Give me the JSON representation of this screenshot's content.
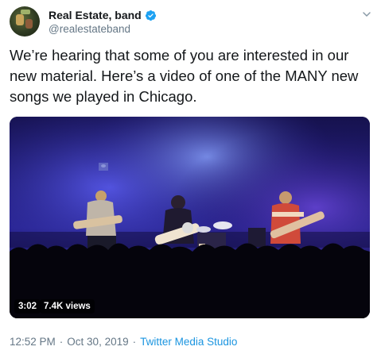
{
  "author": {
    "display_name": "Real Estate, band",
    "handle": "@realestateband",
    "verified": true
  },
  "tweet": {
    "text_lines": [
      "We’re hearing that some of you are interested in our",
      "new material. Here’s a video of one of the MANY new",
      "songs we played in Chicago."
    ]
  },
  "video": {
    "duration": "3:02",
    "views": "7.4K views"
  },
  "meta": {
    "time": "12:52 PM",
    "separator": "·",
    "date": "Oct 30, 2019",
    "source": "Twitter Media Studio"
  },
  "icons": {
    "verified": "verified-badge-icon",
    "caret": "chevron-down-icon"
  },
  "colors": {
    "accent": "#1b95e0",
    "verified": "#1da1f2",
    "secondary_text": "#657786"
  }
}
